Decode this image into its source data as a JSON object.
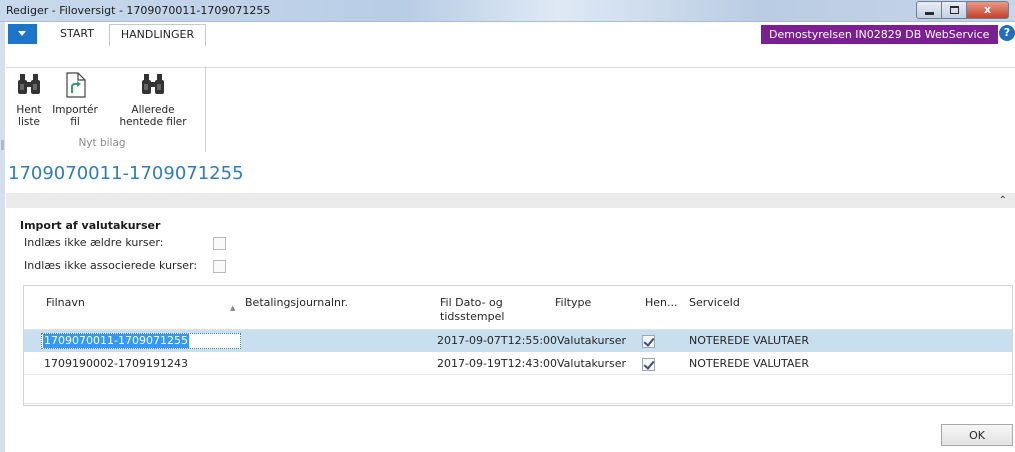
{
  "window": {
    "title": "Rediger - Filoversigt - 1709070011-1709071255",
    "controls": {
      "minimize": "–",
      "maximize": "□",
      "close": "x"
    }
  },
  "ribbon": {
    "tabs": [
      {
        "label": "START"
      },
      {
        "label": "HANDLINGER"
      }
    ],
    "company": "Demostyrelsen IN02829 DB WebService",
    "help_label": "?",
    "group_label": "Nyt bilag",
    "actions": [
      {
        "label": "Hent\nliste",
        "icon": "binoculars-icon"
      },
      {
        "label": "Importér\nfil",
        "icon": "import-file-icon"
      },
      {
        "label": "Allerede\nhentede filer",
        "icon": "binoculars-icon"
      }
    ]
  },
  "page": {
    "title": "1709070011-1709071255"
  },
  "section": {
    "title": "Import af valutakurser",
    "fields": [
      {
        "label": "Indlæs ikke ældre kurser:"
      },
      {
        "label": "Indlæs ikke associerede kurser:"
      }
    ]
  },
  "table": {
    "columns": [
      "Filnavn",
      "Betalingsjournalnr.",
      "Fil Dato- og\ntidsstempel",
      "Filtype",
      "Hen...",
      "ServiceId"
    ],
    "rows": [
      {
        "filnavn": "1709070011-1709071255",
        "betalingsjournalnr": "",
        "dato": "2017-09-07T12:55:00",
        "filtype": "Valutakurser",
        "hentet": true,
        "serviceid": "NOTEREDE VALUTAER"
      },
      {
        "filnavn": "1709190002-1709191243",
        "betalingsjournalnr": "",
        "dato": "2017-09-19T12:43:00",
        "filtype": "Valutakurser",
        "hentet": true,
        "serviceid": "NOTEREDE VALUTAER"
      }
    ]
  },
  "footer": {
    "ok_label": "OK"
  },
  "colors": {
    "accent": "#2e7bc4",
    "app_menu": "#1c75c7",
    "company_badge": "#7b1f92",
    "selected_row": "#c8dff0",
    "selection": "#3399ff"
  }
}
